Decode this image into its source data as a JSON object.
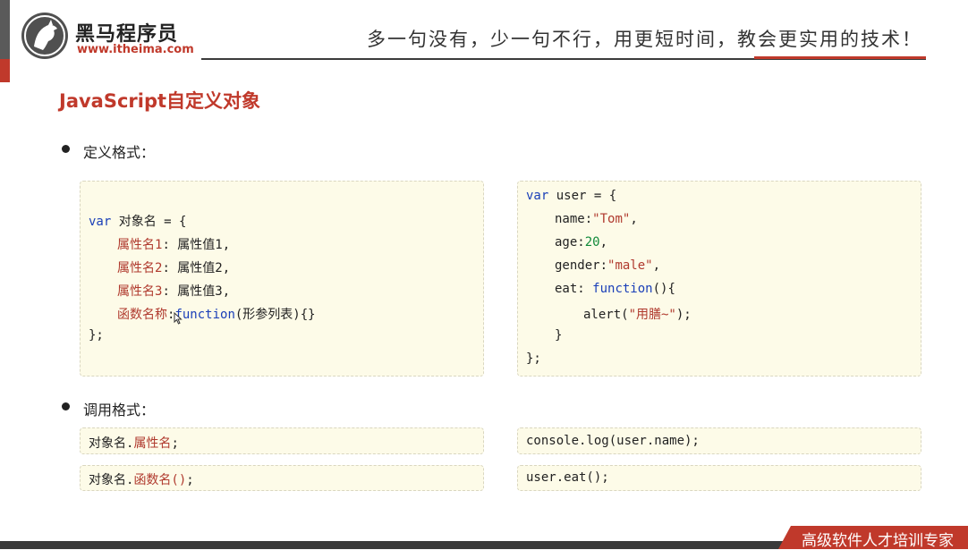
{
  "header": {
    "logo_cn": "黑马程序员",
    "logo_url": "www.itheima.com",
    "slogan": "多一句没有，少一句不行，用更短时间，教会更实用的技术！"
  },
  "title": "JavaScript自定义对象",
  "sections": {
    "define_label": "定义格式：",
    "invoke_label": "调用格式："
  },
  "define_template": {
    "line1_kw": "var",
    "line1_rest": " 对象名 = {",
    "line2_prop": "属性名1",
    "line2_rest": ": 属性值1,",
    "line3_prop": "属性名2",
    "line3_rest": ": 属性值2,",
    "line4_prop": "属性名3",
    "line4_rest": ": 属性值3,",
    "line5_prop": "函数名称",
    "line5_colon": ":",
    "line5_kw": "function",
    "line5_rest": "(形参列表){}",
    "line6": "};"
  },
  "define_example": {
    "line1_kw": "var",
    "line1_rest": " user = {",
    "line2_key": "name:",
    "line2_val": "\"Tom\"",
    "line2_end": ",",
    "line3_key": "age:",
    "line3_val": "20",
    "line3_end": ",",
    "line4_key": "gender:",
    "line4_val": "\"male\"",
    "line4_end": ",",
    "line5_key": "eat: ",
    "line5_kw": "function",
    "line5_rest": "(){",
    "line6_start": "alert(",
    "line6_str": "\"用膳~\"",
    "line6_end": ");",
    "line7": "}",
    "line8": "};"
  },
  "invoke_template": {
    "prop_prefix": "对象名.",
    "prop_name": "属性名",
    "prop_end": ";",
    "func_prefix": "对象名.",
    "func_name": "函数名()",
    "func_end": ";"
  },
  "invoke_example": {
    "prop_line": "console.log(user.name);",
    "func_line": "user.eat();"
  },
  "footer": {
    "text": "高级软件人才培训专家"
  },
  "colors": {
    "brand_red": "#c0392b",
    "keyword_blue": "#1a3fb8",
    "number_green": "#118a3a",
    "code_bg": "#fdfbe8"
  }
}
